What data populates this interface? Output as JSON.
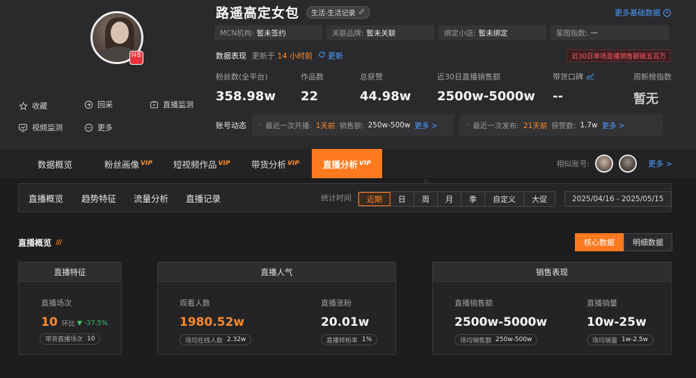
{
  "profile": {
    "name": "路遥高定女包",
    "category_tag": "生活-生活记录",
    "platform_badge": "抖音"
  },
  "header_actions": [
    {
      "label": "收藏",
      "icon": "star-icon"
    },
    {
      "label": "回采",
      "icon": "arrow-return-icon"
    },
    {
      "label": "直播监测",
      "icon": "live-monitor-icon"
    },
    {
      "label": "视频监测",
      "icon": "video-chart-icon"
    },
    {
      "label": "更多",
      "icon": "more-dots-icon"
    }
  ],
  "more_basic_data": "更多基础数据",
  "info": {
    "mcn_label": "MCN机构:",
    "mcn_value": "暂未签约",
    "brand_label": "关联品牌:",
    "brand_value": "暂未关联",
    "shop_label": "绑定小店:",
    "shop_value": "暂未绑定",
    "star_label": "星图指数:",
    "star_value": "—"
  },
  "performance": {
    "title": "数据表现",
    "updated_prefix": "更新于",
    "updated_value": "14 小时前",
    "refresh_label": "更新",
    "alert": "近30日单场直播销售额破五百万"
  },
  "metrics": [
    {
      "label": "粉丝数(全平台)",
      "value": "358.98w"
    },
    {
      "label": "作品数",
      "value": "22"
    },
    {
      "label": "总获赞",
      "value": "44.98w"
    },
    {
      "label": "近30日直播销售额",
      "value": "2500w-5000w"
    },
    {
      "label": "带货口碑",
      "value": "--"
    },
    {
      "label": "周新榜指数",
      "value": "暂无"
    }
  ],
  "dynamics": {
    "title": "账号动态",
    "live_prefix": "最近一次开播:",
    "live_when": "1天前",
    "sales_label": "销售额:",
    "sales_value": "250w-500w",
    "more1": "更多 >",
    "post_prefix": "最近一次发布:",
    "post_when": "21天前",
    "likes_label": "获赞数:",
    "likes_value": "1.7w",
    "more2": "更多 >"
  },
  "tabs": [
    {
      "label": "数据概览",
      "vip": ""
    },
    {
      "label": "粉丝画像",
      "vip": "VIP"
    },
    {
      "label": "短视频作品",
      "vip": "VIP"
    },
    {
      "label": "带货分析",
      "vip": "VIP"
    },
    {
      "label": "直播分析",
      "vip": "VIP"
    }
  ],
  "similar": {
    "label": "相似账号:",
    "more": "更多 >"
  },
  "subtabs": [
    "直播概览",
    "趋势特征",
    "流量分析",
    "直播记录"
  ],
  "stat_time_label": "统计时间",
  "periods": [
    "近期",
    "日",
    "周",
    "月",
    "季",
    "自定义",
    "大促"
  ],
  "date_range": "2025/04/16 - 2025/05/15",
  "overview": {
    "title": "直播概览",
    "toggle_core": "核心数据",
    "toggle_detail": "明细数据"
  },
  "cards": {
    "features": {
      "title": "直播特征",
      "sessions_label": "直播场次",
      "sessions_value": "10",
      "change_prefix": "环比",
      "change_value": "-37.5%",
      "sub_label": "带货直播场次",
      "sub_value": "10"
    },
    "popularity": {
      "title": "直播人气",
      "viewers_label": "观看人数",
      "viewers_value": "1980.52w",
      "viewers_sub_label": "场均在线人数",
      "viewers_sub_value": "2.32w",
      "fans_label": "直播涨粉",
      "fans_value": "20.01w",
      "fans_sub_label": "直播转粉率",
      "fans_sub_value": "1%"
    },
    "sales": {
      "title": "销售表现",
      "gmv_label": "直播销售额",
      "gmv_value": "2500w-5000w",
      "gmv_sub_label": "场均销售额",
      "gmv_sub_value": "250w-500w",
      "volume_label": "直播销量",
      "volume_value": "10w-25w",
      "volume_sub_label": "场均销量",
      "volume_sub_value": "1w-2.5w"
    }
  },
  "colors": {
    "accent": "#ff7a1f",
    "link": "#4d9bff",
    "alert": "#ff5a5f",
    "down": "#3fbf6a"
  }
}
